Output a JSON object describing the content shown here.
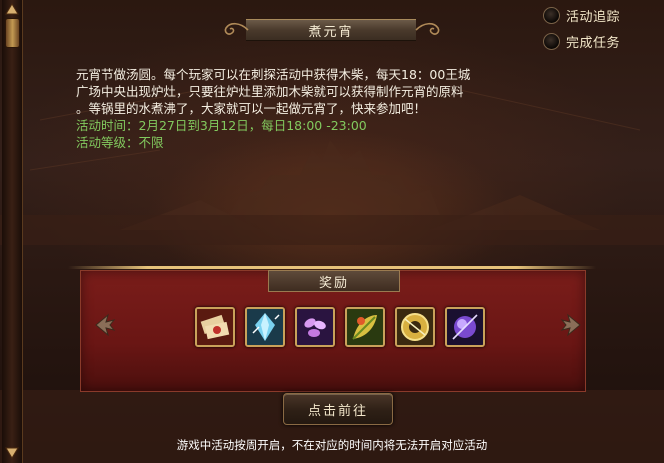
{
  "tracker": {
    "activity_tracking_label": "活动追踪",
    "complete_task_label": "完成任务"
  },
  "event": {
    "title": "煮元宵",
    "description_lines": [
      "元宵节做汤圆。每个玩家可以在刺探活动中获得木柴，每天18：00王城",
      "广场中央出现炉灶，只要往炉灶里添加木柴就可以获得制作元宵的原料",
      "。等锅里的水煮沸了，大家就可以一起做元宵了，快来参加吧！"
    ],
    "time_label": "活动时间：2月27日到3月12日，每日18:00 -23:00",
    "level_label": "活动等级：不限"
  },
  "rewards": {
    "title": "奖励",
    "items": [
      {
        "icon": "scroll-ticket-icon"
      },
      {
        "icon": "blue-crystal-icon"
      },
      {
        "icon": "purple-petals-icon"
      },
      {
        "icon": "golden-leaf-icon"
      },
      {
        "icon": "jade-coin-icon"
      },
      {
        "icon": "purple-orb-icon"
      }
    ]
  },
  "actions": {
    "go_button_label": "点击前往"
  },
  "footer": {
    "note": "游戏中活动按周开启，不在对应的时间内将无法开启对应活动"
  },
  "colors": {
    "highlight_green": "#82c95e",
    "reward_panel_red": "#6a1614",
    "gold_border": "#c9a25a"
  }
}
